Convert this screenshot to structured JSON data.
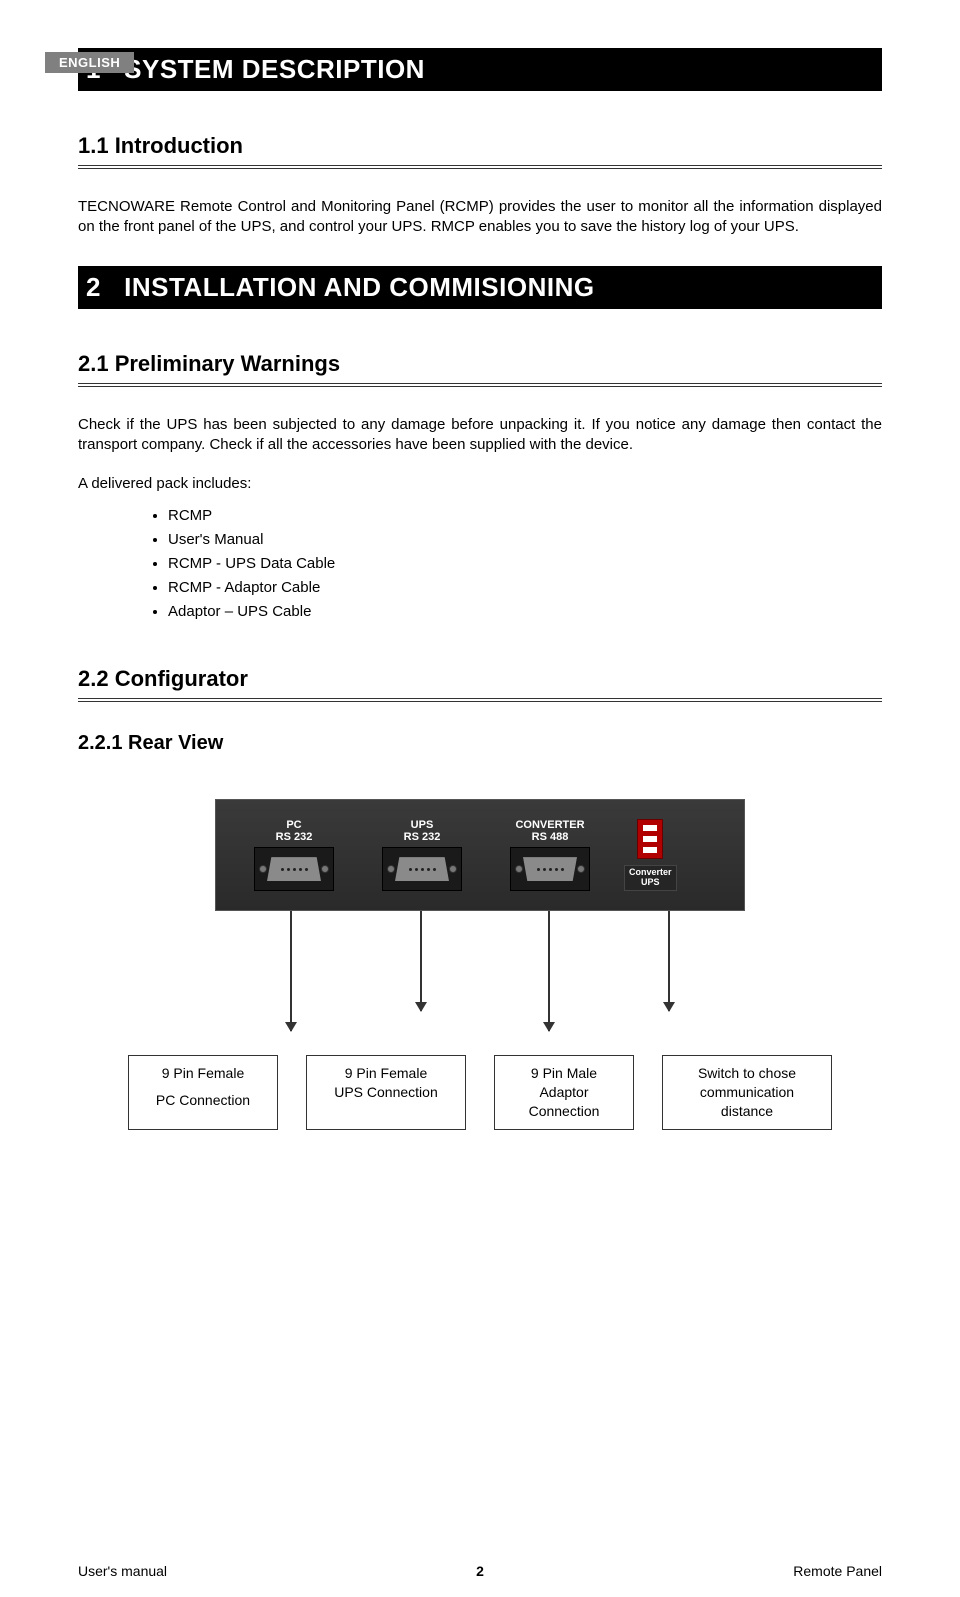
{
  "lang_tab": "ENGLISH",
  "section1": {
    "number": "1",
    "title": "SYSTEM DESCRIPTION",
    "sub1_1": "1.1   Introduction",
    "intro_text": "TECNOWARE Remote Control and Monitoring Panel (RCMP) provides the user to monitor all the information displayed on the front panel of the UPS, and control your UPS. RMCP enables you to save the history log of your UPS."
  },
  "section2": {
    "number": "2",
    "title": "INSTALLATION AND COMMISIONING",
    "sub2_1": "2.1   Preliminary Warnings",
    "warn_text": "Check if the UPS has been subjected to any damage before unpacking it. If you notice any damage then contact the transport company. Check if all the accessories have been supplied with the device.",
    "pack_intro": "A delivered pack includes:",
    "pack_items": [
      "RCMP",
      "User's Manual",
      "RCMP - UPS Data Cable",
      "RCMP - Adaptor Cable",
      "Adaptor – UPS Cable"
    ],
    "sub2_2": "2.2   Configurator",
    "sub2_2_1": "2.2.1 Rear View"
  },
  "panel": {
    "port1_top": "PC",
    "port1_bot": "RS 232",
    "port2_top": "UPS",
    "port2_bot": "RS 232",
    "port3_top": "CONVERTER",
    "port3_bot": "RS 488",
    "switch_label_top": "Converter",
    "switch_label_bot": "UPS"
  },
  "callouts": {
    "c1_l1": "9 Pin Female",
    "c1_l2": "PC Connection",
    "c2_l1": "9 Pin Female",
    "c2_l2": "UPS Connection",
    "c3_l1": "9 Pin Male",
    "c3_l2": "Adaptor",
    "c3_l3": "Connection",
    "c4_l1": "Switch to chose",
    "c4_l2": "communication",
    "c4_l3": "distance"
  },
  "footer": {
    "left": "User's manual",
    "center": "2",
    "right": "Remote Panel"
  }
}
